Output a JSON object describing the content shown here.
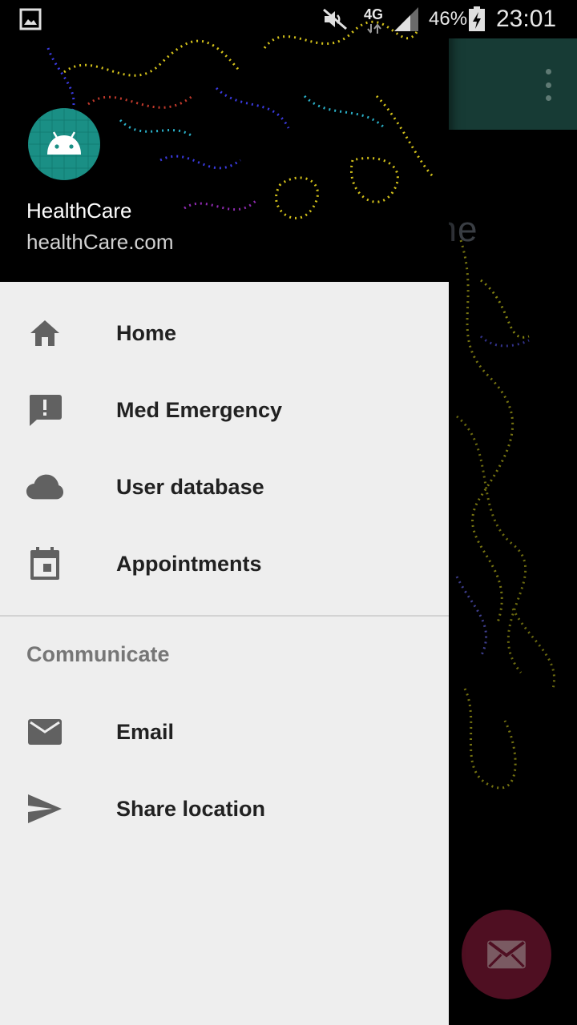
{
  "status_bar": {
    "signal": "4G",
    "battery_percent": "46%",
    "time": "23:01",
    "icons": [
      "gallery-icon",
      "mute-icon",
      "network-4g-icon",
      "signal-icon",
      "battery-charging-icon"
    ]
  },
  "background_app": {
    "headline_fragment": "one",
    "toolbar_menu_icon": "more-vert-icon",
    "fab_icon": "mail-icon",
    "colors": {
      "appbar": "#173b35",
      "fab": "#4f0f22"
    }
  },
  "drawer": {
    "header": {
      "user_name": "HealthCare",
      "user_email": "healthCare.com",
      "avatar_icon": "android-icon"
    },
    "items": [
      {
        "label": "Home",
        "icon": "home-icon"
      },
      {
        "label": "Med Emergency",
        "icon": "report-icon"
      },
      {
        "label": "User database",
        "icon": "cloud-icon"
      },
      {
        "label": "Appointments",
        "icon": "event-icon"
      }
    ],
    "section": {
      "title": "Communicate",
      "items": [
        {
          "label": "Email",
          "icon": "mail-icon"
        },
        {
          "label": "Share location",
          "icon": "send-icon"
        }
      ]
    },
    "colors": {
      "background": "#eeeeee",
      "icon": "#616161",
      "text": "#212121",
      "section_title": "#767676"
    }
  }
}
